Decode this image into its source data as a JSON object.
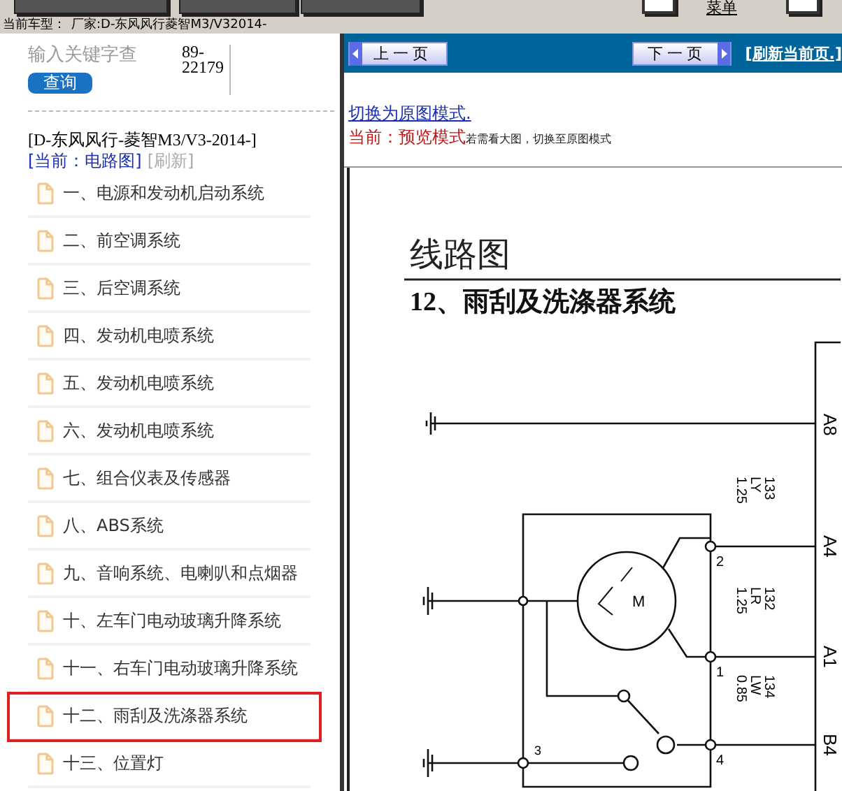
{
  "toolbar": {
    "menu_label": "菜单"
  },
  "vehicle_bar": {
    "label": "当前车型：",
    "value": "厂家:D-东风风行菱智M3/V32014-"
  },
  "sidebar": {
    "search": {
      "placeholder": "输入关键字查"
    },
    "search_button": "查询",
    "code": "89-22179",
    "vehicle_title": "[D-东风风行-菱智M3/V3-2014-]",
    "current": "[当前：电路图]",
    "refresh": "[刷新]",
    "items": [
      {
        "label": "一、电源和发动机启动系统",
        "selected": false
      },
      {
        "label": "二、前空调系统",
        "selected": false
      },
      {
        "label": "三、后空调系统",
        "selected": false
      },
      {
        "label": "四、发动机电喷系统",
        "selected": false
      },
      {
        "label": "五、发动机电喷系统",
        "selected": false
      },
      {
        "label": "六、发动机电喷系统",
        "selected": false
      },
      {
        "label": "七、组合仪表及传感器",
        "selected": false
      },
      {
        "label": "八、ABS系统",
        "selected": false
      },
      {
        "label": "九、音响系统、电喇叭和点烟器",
        "selected": false
      },
      {
        "label": "十、左车门电动玻璃升降系统",
        "selected": false
      },
      {
        "label": "十一、右车门电动玻璃升降系统",
        "selected": false
      },
      {
        "label": "十二、雨刮及洗涤器系统",
        "selected": true
      },
      {
        "label": "十三、位置灯",
        "selected": false
      }
    ]
  },
  "viewer": {
    "prev_button": "上一页",
    "next_button": "下一页",
    "refresh_link": "[刷新当前页.]",
    "switch_link": "切换为原图模式.",
    "mode_label": "当前：",
    "mode_value": "预览模式",
    "mode_hint": "若需看大图，切换至原图模式",
    "diagram": {
      "title": "线路图",
      "heading": "12、雨刮及洗涤器系统",
      "ground_terminal": "A8",
      "motor_label": "M",
      "connectors": [
        {
          "terminal": "A4",
          "pin": "2",
          "circuit": "133",
          "wire_color": "LY",
          "gauge": "1.25"
        },
        {
          "terminal": "A1",
          "pin": "1",
          "circuit": "132",
          "wire_color": "LR",
          "gauge": "1.25"
        },
        {
          "terminal": "B4",
          "pin": "4",
          "circuit": "134",
          "wire_color": "LW",
          "gauge": "0.85"
        }
      ],
      "ground_pin": "3"
    }
  }
}
